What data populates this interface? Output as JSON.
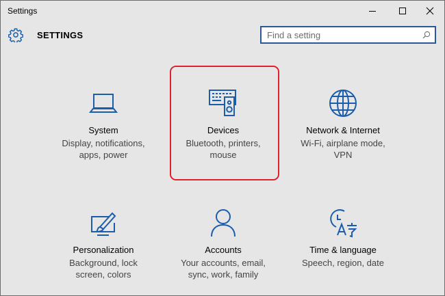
{
  "window": {
    "title": "Settings",
    "controls": {
      "minimize": "minimize",
      "maximize": "maximize",
      "close": "close"
    }
  },
  "header": {
    "title": "SETTINGS",
    "icon": "gear-icon"
  },
  "search": {
    "value": "",
    "placeholder": "Find a setting",
    "icon": "search-icon"
  },
  "colors": {
    "accent": "#1b5dab",
    "highlight": "#e0202e",
    "background": "#e6e6e6"
  },
  "tiles": [
    {
      "icon": "laptop-icon",
      "title": "System",
      "desc1": "Display, notifications,",
      "desc2": "apps, power"
    },
    {
      "icon": "keyboard-speaker-icon",
      "title": "Devices",
      "desc1": "Bluetooth, printers,",
      "desc2": "mouse"
    },
    {
      "icon": "globe-icon",
      "title": "Network & Internet",
      "desc1": "Wi-Fi, airplane mode,",
      "desc2": "VPN"
    },
    {
      "icon": "paint-screen-icon",
      "title": "Personalization",
      "desc1": "Background, lock",
      "desc2": "screen, colors"
    },
    {
      "icon": "person-icon",
      "title": "Accounts",
      "desc1": "Your accounts, email,",
      "desc2": "sync, work, family"
    },
    {
      "icon": "time-language-icon",
      "title": "Time & language",
      "desc1": "Speech, region, date",
      "desc2": ""
    }
  ]
}
